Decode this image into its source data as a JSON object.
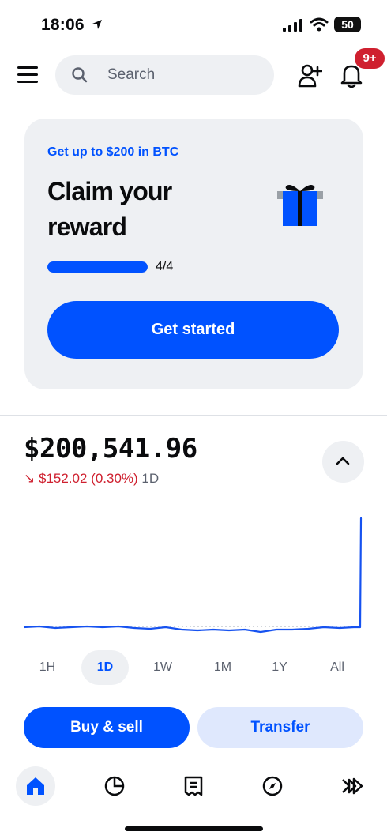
{
  "status_bar": {
    "time": "18:06",
    "battery": "50"
  },
  "header": {
    "search_placeholder": "Search",
    "notification_count": "9+",
    "icons": [
      "menu-icon",
      "search-icon",
      "add-user-icon",
      "bell-icon"
    ]
  },
  "promo": {
    "eyebrow": "Get up to $200 in BTC",
    "headline": "Claim your reward",
    "progress_text": "4/4",
    "progress_fraction": 1.0,
    "cta_label": "Get started",
    "icon": "gift-icon"
  },
  "portfolio": {
    "balance": "$200,541.96",
    "change_arrow": "↘",
    "change_amount": "$152.02 (0.30%)",
    "change_period": "1D"
  },
  "time_ranges": [
    {
      "label": "1H",
      "active": false
    },
    {
      "label": "1D",
      "active": true
    },
    {
      "label": "1W",
      "active": false
    },
    {
      "label": "1M",
      "active": false
    },
    {
      "label": "1Y",
      "active": false
    },
    {
      "label": "All",
      "active": false
    }
  ],
  "actions": {
    "buy_sell_label": "Buy & sell",
    "transfer_label": "Transfer"
  },
  "bottom_nav": [
    {
      "name": "home-icon",
      "active": true
    },
    {
      "name": "portfolio-icon",
      "active": false
    },
    {
      "name": "transactions-icon",
      "active": false
    },
    {
      "name": "explore-icon",
      "active": false
    },
    {
      "name": "trade-icon",
      "active": false
    }
  ],
  "colors": {
    "brand": "#0052ff",
    "negative": "#cf202f",
    "surface": "#eef0f3",
    "chart_line": "#1652f0"
  }
}
